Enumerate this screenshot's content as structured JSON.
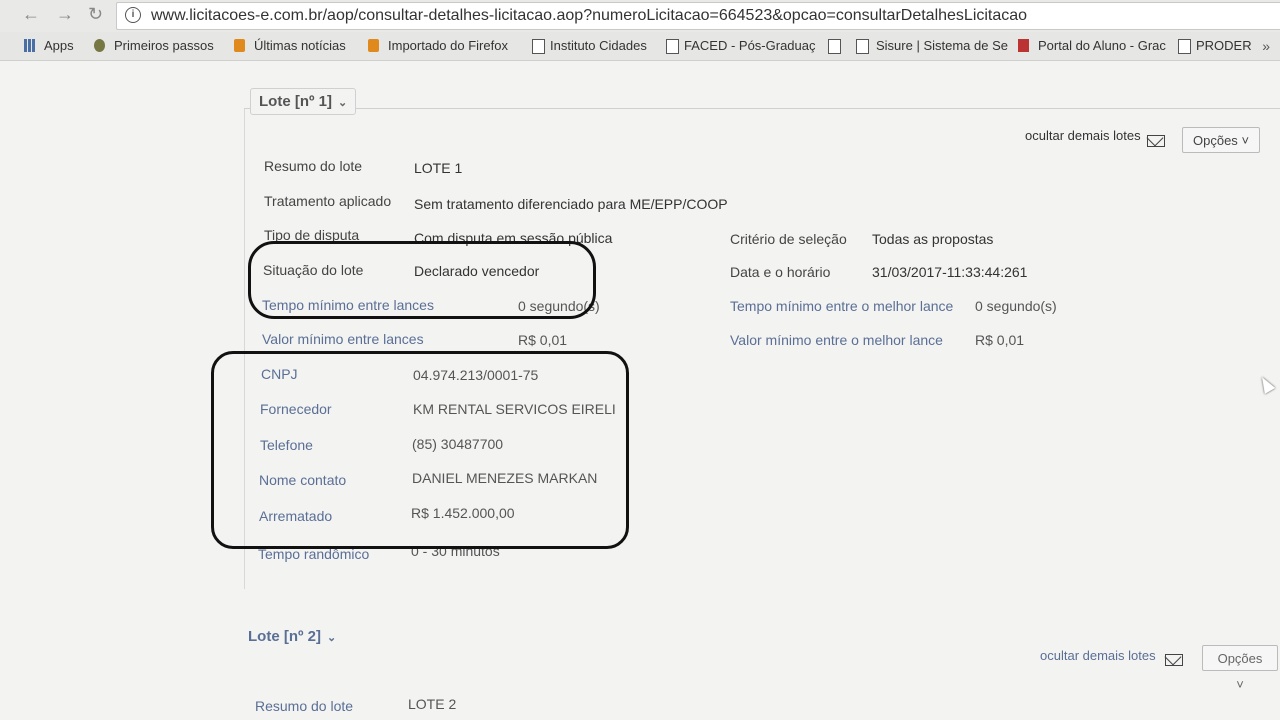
{
  "browser": {
    "url": "www.licitacoes-e.com.br/aop/consultar-detalhes-licitacao.aop?numeroLicitacao=664523&opcao=consultarDetalhesLicitacao",
    "bookmarks": [
      "Apps",
      "Primeiros passos",
      "Últimas notícias",
      "Importado do Firefox",
      "Instituto Cidades",
      "FACED - Pós-Graduaç",
      "",
      "Sisure | Sistema de Se",
      "Portal do Aluno - Grac",
      "PRODER"
    ]
  },
  "lote1": {
    "title": "Lote [nº 1]",
    "hide_label": "ocultar demais lotes",
    "options_label": "Opções",
    "fields": {
      "resumo_label": "Resumo do lote",
      "resumo_value": "LOTE 1",
      "tratamento_label": "Tratamento aplicado",
      "tratamento_value": "Sem tratamento diferenciado para ME/EPP/COOP",
      "tipo_label": "Tipo de disputa",
      "tipo_value": "Com disputa em sessão pública",
      "criterio_label": "Critério de seleção",
      "criterio_value": "Todas as propostas",
      "situacao_label": "Situação do lote",
      "situacao_value": "Declarado vencedor",
      "data_label": "Data e o horário",
      "data_value": "31/03/2017-11:33:44:261",
      "tempo_lances_label": "Tempo mínimo entre lances",
      "tempo_lances_value": "0 segundo(s)",
      "tempo_melhor_label": "Tempo mínimo entre o melhor lance",
      "tempo_melhor_value": "0 segundo(s)",
      "valor_lances_label": "Valor mínimo entre lances",
      "valor_lances_value": "R$ 0,01",
      "valor_melhor_label": "Valor mínimo entre o melhor lance",
      "valor_melhor_value": "R$ 0,01",
      "cnpj_label": "CNPJ",
      "cnpj_value": "04.974.213/0001-75",
      "fornecedor_label": "Fornecedor",
      "fornecedor_value": "KM RENTAL SERVICOS EIRELI",
      "telefone_label": "Telefone",
      "telefone_value": "(85) 30487700",
      "contato_label": "Nome contato",
      "contato_value": "DANIEL MENEZES MARKAN",
      "arrematado_label": "Arrematado",
      "arrematado_value": "R$ 1.452.000,00",
      "randomico_label": "Tempo randômico",
      "randomico_value": "0 - 30 minutos"
    }
  },
  "lote2": {
    "title": "Lote [nº 2]",
    "hide_label": "ocultar demais lotes",
    "options_label": "Opções",
    "resumo_label": "Resumo do lote",
    "resumo_value": "LOTE 2"
  }
}
